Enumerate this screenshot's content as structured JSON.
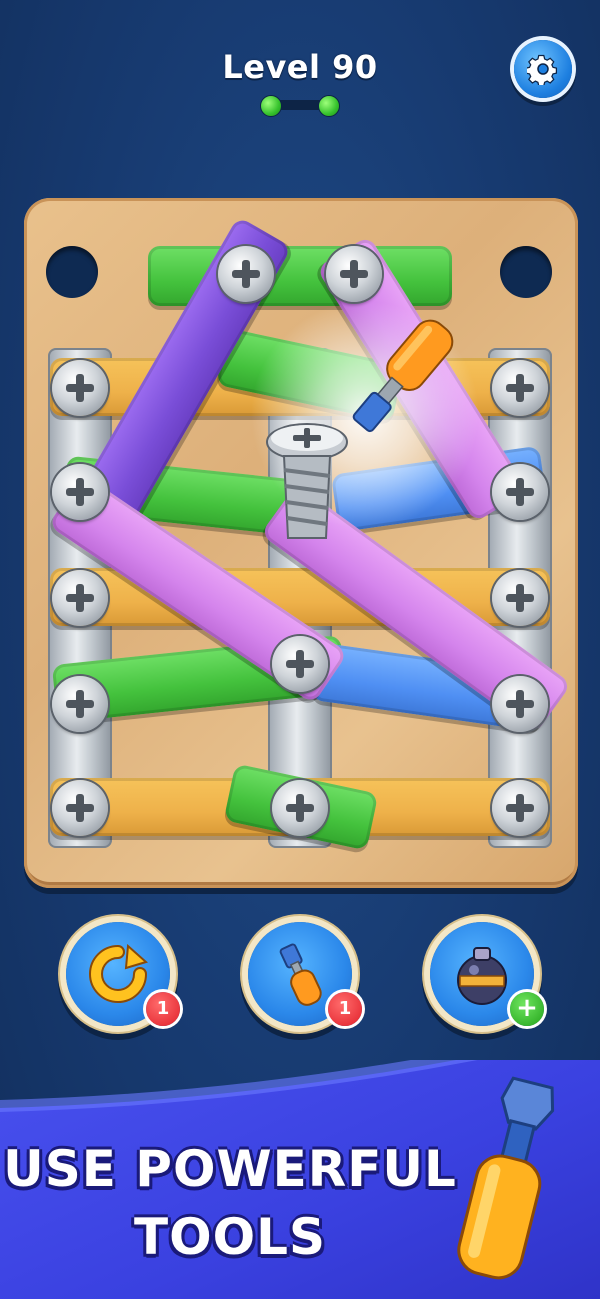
{
  "header": {
    "level_title": "Level 90",
    "progress_dots": 2,
    "settings_icon": "gear-icon"
  },
  "board": {
    "planks": [
      "orange",
      "green",
      "blue",
      "purple",
      "pink"
    ],
    "screw_icon": "plus-screw-icon",
    "highlighted_tool": "screwdriver-icon"
  },
  "tools": {
    "undo": {
      "icon": "rotate-arrow-icon",
      "count": "1"
    },
    "screwdriver": {
      "icon": "screwdriver-icon",
      "count": "1"
    },
    "bomb": {
      "icon": "bomb-icon",
      "count": "+"
    }
  },
  "promo": {
    "line1": "USE POWERFUL",
    "line2": "TOOLS"
  },
  "colors": {
    "background": "#173a70",
    "board": "#e3b77f",
    "banner": "#3c45e6",
    "accent_button": "#2b88ea"
  }
}
